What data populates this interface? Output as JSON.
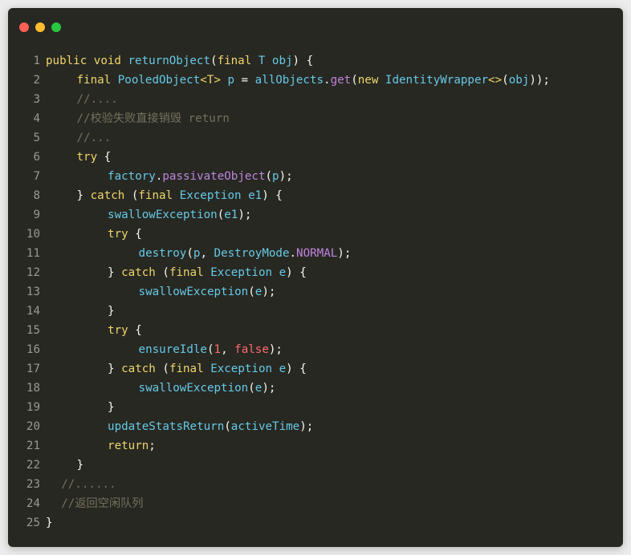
{
  "window": {
    "controls": [
      {
        "name": "close",
        "color": "#ff5f56"
      },
      {
        "name": "minimize",
        "color": "#ffbd2e"
      },
      {
        "name": "zoom",
        "color": "#27c93f"
      }
    ]
  },
  "code": {
    "language": "java",
    "lines": [
      {
        "n": "1",
        "indent": 0,
        "tokens": [
          [
            "kw",
            "public "
          ],
          [
            "kw",
            "void "
          ],
          [
            "fn",
            "returnObject"
          ],
          [
            "plain",
            "("
          ],
          [
            "kw",
            "final "
          ],
          [
            "type",
            "T "
          ],
          [
            "var",
            "obj"
          ],
          [
            "plain",
            ") {"
          ]
        ]
      },
      {
        "n": "2",
        "indent": 4,
        "tokens": [
          [
            "kw",
            "final "
          ],
          [
            "type",
            "PooledObject"
          ],
          [
            "gen",
            "<T>"
          ],
          [
            "plain",
            " "
          ],
          [
            "var",
            "p"
          ],
          [
            "plain",
            " = "
          ],
          [
            "var",
            "allObjects"
          ],
          [
            "plain",
            "."
          ],
          [
            "meth",
            "get"
          ],
          [
            "plain",
            "("
          ],
          [
            "kw",
            "new "
          ],
          [
            "type",
            "IdentityWrapper"
          ],
          [
            "gen",
            "<>"
          ],
          [
            "plain",
            "("
          ],
          [
            "var",
            "obj"
          ],
          [
            "plain",
            "));"
          ]
        ]
      },
      {
        "n": "3",
        "indent": 4,
        "tokens": [
          [
            "com",
            "//...."
          ]
        ]
      },
      {
        "n": "4",
        "indent": 4,
        "tokens": [
          [
            "com",
            "//校验失败直接销毁 return"
          ]
        ]
      },
      {
        "n": "5",
        "indent": 4,
        "tokens": [
          [
            "com",
            "//..."
          ]
        ]
      },
      {
        "n": "6",
        "indent": 4,
        "tokens": [
          [
            "kw",
            "try"
          ],
          [
            "plain",
            " {"
          ]
        ]
      },
      {
        "n": "7",
        "indent": 8,
        "tokens": [
          [
            "var",
            "factory"
          ],
          [
            "plain",
            "."
          ],
          [
            "meth",
            "passivateObject"
          ],
          [
            "plain",
            "("
          ],
          [
            "var",
            "p"
          ],
          [
            "plain",
            ");"
          ]
        ]
      },
      {
        "n": "8",
        "indent": 4,
        "tokens": [
          [
            "plain",
            "} "
          ],
          [
            "kw",
            "catch"
          ],
          [
            "plain",
            " ("
          ],
          [
            "kw",
            "final "
          ],
          [
            "type",
            "Exception "
          ],
          [
            "var",
            "e1"
          ],
          [
            "plain",
            ") {"
          ]
        ]
      },
      {
        "n": "9",
        "indent": 8,
        "tokens": [
          [
            "fn",
            "swallowException"
          ],
          [
            "plain",
            "("
          ],
          [
            "var",
            "e1"
          ],
          [
            "plain",
            ");"
          ]
        ]
      },
      {
        "n": "10",
        "indent": 8,
        "tokens": [
          [
            "kw",
            "try"
          ],
          [
            "plain",
            " {"
          ]
        ]
      },
      {
        "n": "11",
        "indent": 12,
        "tokens": [
          [
            "fn",
            "destroy"
          ],
          [
            "plain",
            "("
          ],
          [
            "var",
            "p"
          ],
          [
            "plain",
            ", "
          ],
          [
            "type",
            "DestroyMode"
          ],
          [
            "plain",
            "."
          ],
          [
            "const",
            "NORMAL"
          ],
          [
            "plain",
            ");"
          ]
        ]
      },
      {
        "n": "12",
        "indent": 8,
        "tokens": [
          [
            "plain",
            "} "
          ],
          [
            "kw",
            "catch"
          ],
          [
            "plain",
            " ("
          ],
          [
            "kw",
            "final "
          ],
          [
            "type",
            "Exception "
          ],
          [
            "var",
            "e"
          ],
          [
            "plain",
            ") {"
          ]
        ]
      },
      {
        "n": "13",
        "indent": 12,
        "tokens": [
          [
            "fn",
            "swallowException"
          ],
          [
            "plain",
            "("
          ],
          [
            "var",
            "e"
          ],
          [
            "plain",
            ");"
          ]
        ]
      },
      {
        "n": "14",
        "indent": 8,
        "tokens": [
          [
            "plain",
            "}"
          ]
        ]
      },
      {
        "n": "15",
        "indent": 8,
        "tokens": [
          [
            "kw",
            "try"
          ],
          [
            "plain",
            " {"
          ]
        ]
      },
      {
        "n": "16",
        "indent": 12,
        "tokens": [
          [
            "fn",
            "ensureIdle"
          ],
          [
            "plain",
            "("
          ],
          [
            "num",
            "1"
          ],
          [
            "plain",
            ", "
          ],
          [
            "bool",
            "false"
          ],
          [
            "plain",
            ");"
          ]
        ]
      },
      {
        "n": "17",
        "indent": 8,
        "tokens": [
          [
            "plain",
            "} "
          ],
          [
            "kw",
            "catch"
          ],
          [
            "plain",
            " ("
          ],
          [
            "kw",
            "final "
          ],
          [
            "type",
            "Exception "
          ],
          [
            "var",
            "e"
          ],
          [
            "plain",
            ") {"
          ]
        ]
      },
      {
        "n": "18",
        "indent": 12,
        "tokens": [
          [
            "fn",
            "swallowException"
          ],
          [
            "plain",
            "("
          ],
          [
            "var",
            "e"
          ],
          [
            "plain",
            ");"
          ]
        ]
      },
      {
        "n": "19",
        "indent": 8,
        "tokens": [
          [
            "plain",
            "}"
          ]
        ]
      },
      {
        "n": "20",
        "indent": 8,
        "tokens": [
          [
            "fn",
            "updateStatsReturn"
          ],
          [
            "plain",
            "("
          ],
          [
            "var",
            "activeTime"
          ],
          [
            "plain",
            ");"
          ]
        ]
      },
      {
        "n": "21",
        "indent": 8,
        "tokens": [
          [
            "kw",
            "return"
          ],
          [
            "plain",
            ";"
          ]
        ]
      },
      {
        "n": "22",
        "indent": 4,
        "tokens": [
          [
            "plain",
            "}"
          ]
        ]
      },
      {
        "n": "23",
        "indent": 2,
        "tokens": [
          [
            "com",
            "//......"
          ]
        ]
      },
      {
        "n": "24",
        "indent": 2,
        "tokens": [
          [
            "com",
            "//返回空闲队列"
          ]
        ]
      },
      {
        "n": "25",
        "indent": 0,
        "tokens": [
          [
            "plain",
            "}"
          ]
        ]
      }
    ]
  }
}
